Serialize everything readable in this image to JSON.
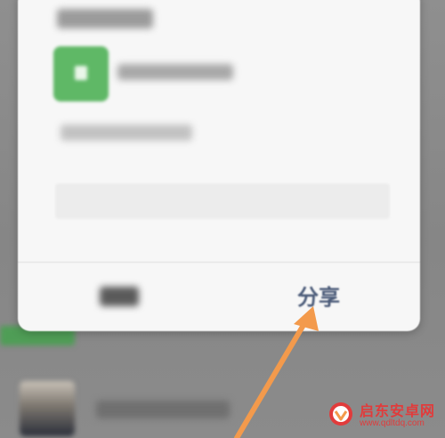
{
  "dialog": {
    "share_label": "分享"
  },
  "watermark": {
    "title": "启东安卓网",
    "url": "www.qdltdq.com"
  },
  "icons": {
    "contact": "document-icon",
    "annotation": "arrow-icon",
    "watermark": "watermark-logo-icon"
  },
  "colors": {
    "accent_green": "#5fb866",
    "share_text": "#4a5a78",
    "arrow": "#f39a4c",
    "watermark_red": "#e13b3b"
  }
}
